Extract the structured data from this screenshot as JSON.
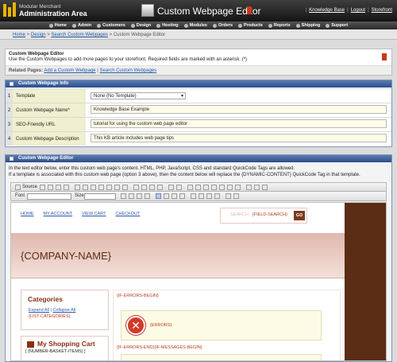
{
  "app": {
    "brand_line1": "Modular Merchant",
    "brand_line2": "Administration Area",
    "page_title": "Custom Webpage Editor",
    "top_links": [
      "Knowledge Base",
      "Logout",
      "Storefront"
    ]
  },
  "nav": [
    "Home",
    "Admin",
    "Customers",
    "Design",
    "Hosting",
    "Modules",
    "Orders",
    "Products",
    "Reports",
    "Shipping",
    "Support"
  ],
  "breadcrumb": [
    "Home",
    "Design",
    "Search Custom Webpages",
    "Custom Webpage Editor"
  ],
  "info": {
    "title": "Custom Webpage Editor",
    "text": "Use the Custom Webpages to add more pages to your storefront. Required fields are marked with an asterisk. (*)",
    "related_label": "Related Pages:",
    "related_links": [
      "Add a Custom Webpage",
      "Search Custom Webpages"
    ]
  },
  "info_panel": {
    "title": "Custom Webpage Info",
    "rows": [
      {
        "num": "1",
        "label": "Template",
        "value": "None (No Template)"
      },
      {
        "num": "2",
        "label": "Custom Webpage Name*",
        "value": "Knowledge Base Example"
      },
      {
        "num": "3",
        "label": "SEO-Friendly URL",
        "value": "tutorial for using the custom web page editor"
      },
      {
        "num": "4",
        "label": "Custom Webpage Description",
        "value": "This KB article includes web page tips"
      }
    ]
  },
  "editor": {
    "title": "Custom Webpage Editor",
    "intro_line1": "In the text editor below, enter this custom web page's content. HTML, PHP, JavaScript, CSS and standard QuickCode Tags are allowed.",
    "intro_line2": "If a template is associated with this custom web page (option 3 above), then the content below will replace the {DYNAMIC-CONTENT} QuickCode Tag in that template.",
    "toolbar": {
      "source": "Source",
      "font": "Font",
      "size": "Size"
    },
    "content": {
      "nav_links": [
        "HOME",
        "MY ACCOUNT",
        "VIEW CART",
        "CHECKOUT"
      ],
      "search_label": "SEARCH",
      "search_tag": "{FIELD-SEARCH}",
      "go": "GO",
      "company": "{COMPANY-NAME}",
      "categories_title": "Categories",
      "expand_all": "Expand All",
      "collapse_all": "Collapse All",
      "list_categories": "{LIST-CATEGORIES}",
      "cart_title": "My Shopping Cart",
      "cart_items": "[ {NUMBER-BASKET-ITEMS} ]",
      "if_errors_begin": "{IF-ERRORS-BEGIN}",
      "errors": "{ERRORS}",
      "if_errors_end": "{IF-ERRORS-END}{IF-MESSAGES-BEGIN}"
    }
  }
}
